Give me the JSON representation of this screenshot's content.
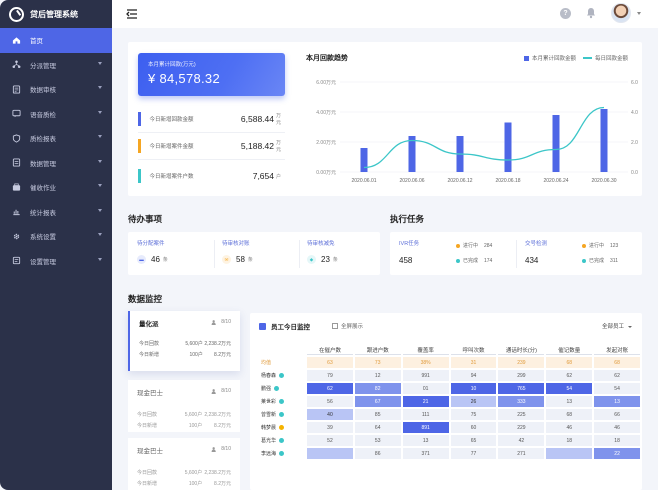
{
  "app": {
    "title": "贷后管理系统"
  },
  "sidebar": {
    "items": [
      {
        "label": "首页",
        "icon": "home-icon",
        "active": true,
        "has_children": false
      },
      {
        "label": "分派管理",
        "icon": "dispatch-icon",
        "has_children": true
      },
      {
        "label": "数据审核",
        "icon": "audit-icon",
        "has_children": true
      },
      {
        "label": "语音质检",
        "icon": "voice-icon",
        "has_children": true
      },
      {
        "label": "质检报表",
        "icon": "shield-icon",
        "has_children": true
      },
      {
        "label": "数据管理",
        "icon": "data-icon",
        "has_children": true
      },
      {
        "label": "催收作业",
        "icon": "collection-icon",
        "has_children": true
      },
      {
        "label": "统计报表",
        "icon": "report-icon",
        "has_children": true
      },
      {
        "label": "系统设置",
        "icon": "gear-icon",
        "has_children": true
      },
      {
        "label": "设置管理",
        "icon": "settings-icon",
        "has_children": true
      }
    ]
  },
  "topbar": {
    "help": "?"
  },
  "summary": {
    "month_label": "本月累计回款(万元)",
    "month_value": "¥ 84,578.32",
    "stats": [
      {
        "label": "今日新增回款金额",
        "value": "6,588.44",
        "unit": "万元",
        "color": "#4e66e6"
      },
      {
        "label": "今日新增案件金额",
        "value": "5,188.42",
        "unit": "万元",
        "color": "#f5a623"
      },
      {
        "label": "今日新增案件户数",
        "value": "7,654",
        "unit": "户",
        "color": "#3cc6c8"
      }
    ]
  },
  "trend": {
    "title": "本月回款趋势",
    "legend_bar": "本月累计回款金额",
    "legend_line": "每日回款金额"
  },
  "chart_data": {
    "type": "bar",
    "title": "本月回款趋势",
    "categories": [
      "2020.06.01",
      "2020.06.06",
      "2020.06.12",
      "2020.06.18",
      "2020.06.24",
      "2020.06.30"
    ],
    "y_ticks": [
      "0.00万元",
      "2.00万元",
      "4.00万元",
      "6.00万元"
    ],
    "ylim": [
      0,
      6
    ],
    "series": [
      {
        "name": "本月累计回款金额",
        "type": "bar",
        "values": [
          1.6,
          2.4,
          2.4,
          3.3,
          3.8,
          4.2
        ],
        "color": "#4e66e6"
      },
      {
        "name": "每日回款金额",
        "type": "line",
        "values": [
          0.3,
          2.1,
          1.2,
          0.8,
          1.5,
          4.3
        ],
        "color": "#3cc6c8"
      }
    ]
  },
  "todo": {
    "title": "待办事项",
    "items": [
      {
        "label": "待分配案件",
        "value": "46",
        "unit": "条",
        "color": "#4e66e6",
        "icon": "folder-icon"
      },
      {
        "label": "待审核对账",
        "value": "58",
        "unit": "条",
        "color": "#f5a623",
        "icon": "envelope-icon"
      },
      {
        "label": "待审核减免",
        "value": "23",
        "unit": "条",
        "color": "#3cc6c8",
        "icon": "bag-icon"
      }
    ]
  },
  "exec": {
    "title": "执行任务",
    "items": [
      {
        "label": "IVR任务",
        "value": "458",
        "running_label": "进行中",
        "running": "284",
        "done_label": "已完成",
        "done": "174"
      },
      {
        "label": "交号检测",
        "value": "434",
        "running_label": "进行中",
        "running": "123",
        "done_label": "已完成",
        "done": "311"
      }
    ]
  },
  "monitor": {
    "title": "数据监控",
    "teams": [
      {
        "name": "量化派",
        "count": "8/10",
        "active": true,
        "rows": [
          [
            "今日回款",
            "5,600户",
            "2,238.2万元"
          ],
          [
            "今日新增",
            "100户",
            "8.2万元"
          ]
        ]
      },
      {
        "name": "现金巴士",
        "count": "8/10",
        "active": false,
        "rows": [
          [
            "今日回款",
            "5,600户",
            "2,238.2万元"
          ],
          [
            "今日新增",
            "100户",
            "8.2万元"
          ]
        ]
      },
      {
        "name": "现金巴士",
        "count": "8/10",
        "active": false,
        "rows": [
          [
            "今日回款",
            "5,600户",
            "2,238.2万元"
          ],
          [
            "今日新增",
            "100户",
            "8.2万元"
          ]
        ]
      }
    ],
    "table": {
      "title": "员工今日监控",
      "fullscreen": "全屏展示",
      "filter": "全部员工",
      "headers": [
        "在催户数",
        "跟进户数",
        "覆盖率",
        "呼叫次数",
        "通话时长(分)",
        "催记数量",
        "发起对账"
      ],
      "rows": [
        {
          "name": "均值",
          "badge": "",
          "cells": [
            "63",
            "73",
            "38%",
            "31",
            "239",
            "68",
            "68"
          ],
          "levels": [
            0,
            0,
            0,
            0,
            0,
            0,
            0
          ],
          "avg": true
        },
        {
          "name": "杨春森",
          "badge": "teal",
          "cells": [
            "79",
            "12",
            "991",
            "94",
            "299",
            "62",
            "62"
          ],
          "levels": [
            0,
            0,
            0,
            0,
            0,
            0,
            0
          ]
        },
        {
          "name": "鹏强",
          "badge": "teal",
          "cells": [
            "62",
            "82",
            "01",
            "10",
            "765",
            "54",
            "54"
          ],
          "levels": [
            4,
            3,
            0,
            4,
            4,
            4,
            0
          ]
        },
        {
          "name": "莱世彩",
          "badge": "teal",
          "cells": [
            "56",
            "67",
            "21",
            "26",
            "333",
            "13",
            "13"
          ],
          "levels": [
            0,
            3,
            4,
            2,
            3,
            0,
            3
          ]
        },
        {
          "name": "曾雪新",
          "badge": "teal",
          "cells": [
            "40",
            "85",
            "111",
            "75",
            "225",
            "68",
            "66"
          ],
          "levels": [
            2,
            0,
            0,
            0,
            0,
            0,
            0
          ]
        },
        {
          "name": "韩梦晨",
          "badge": "yellow",
          "cells": [
            "39",
            "64",
            "891",
            "60",
            "229",
            "46",
            "46"
          ],
          "levels": [
            0,
            0,
            4,
            0,
            0,
            0,
            0
          ]
        },
        {
          "name": "葛光华",
          "badge": "teal",
          "cells": [
            "52",
            "53",
            "13",
            "65",
            "42",
            "18",
            "18"
          ],
          "levels": [
            0,
            0,
            0,
            0,
            0,
            0,
            0
          ]
        },
        {
          "name": "李远海",
          "badge": "teal",
          "cells": [
            "",
            "86",
            "371",
            "77",
            "271",
            "",
            "22"
          ],
          "levels": [
            2,
            0,
            0,
            0,
            0,
            2,
            3
          ]
        }
      ]
    }
  }
}
